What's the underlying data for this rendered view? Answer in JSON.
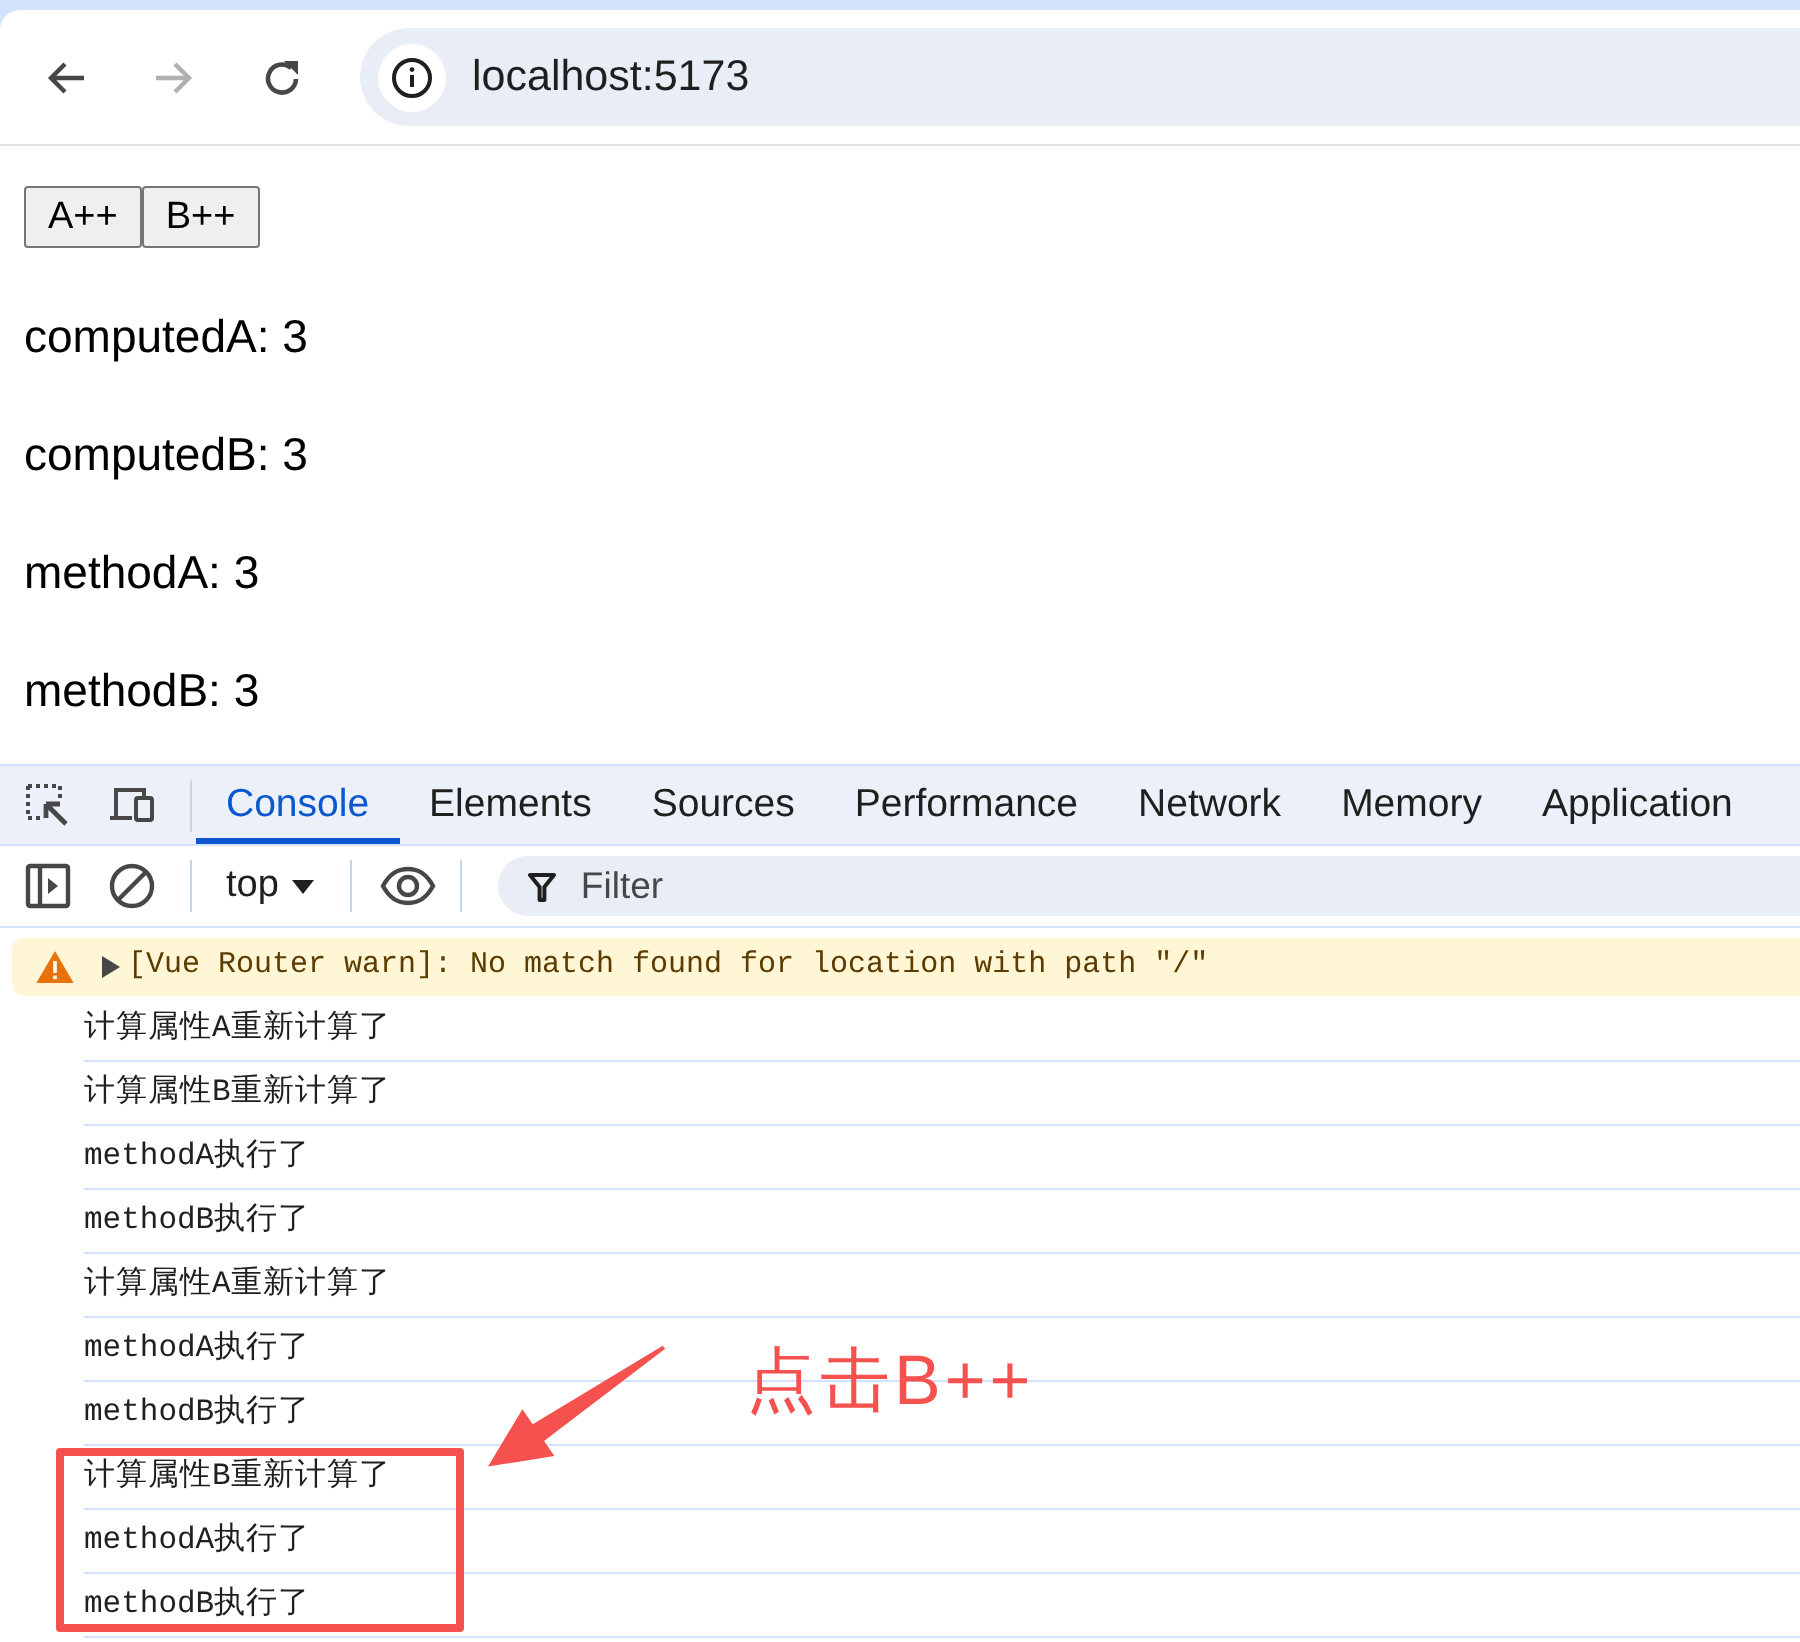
{
  "browser": {
    "nav_buttons": [
      {
        "kind": "back",
        "disabled": false
      },
      {
        "kind": "forward",
        "disabled": true
      },
      {
        "kind": "reload",
        "disabled": false
      }
    ],
    "address": "localhost:5173"
  },
  "page": {
    "buttons": [
      "A++",
      "B++"
    ],
    "lines": [
      "computedA: 3",
      "computedB: 3",
      "methodA: 3",
      "methodB: 3"
    ]
  },
  "devtools": {
    "tabs": [
      {
        "label": "Console",
        "selected": true
      },
      {
        "label": "Elements",
        "selected": false
      },
      {
        "label": "Sources",
        "selected": false
      },
      {
        "label": "Performance",
        "selected": false
      },
      {
        "label": "Network",
        "selected": false
      },
      {
        "label": "Memory",
        "selected": false
      },
      {
        "label": "Application",
        "selected": false
      }
    ],
    "console_toolbar": {
      "context": "top",
      "filter": {
        "placeholder": "Filter"
      }
    },
    "messages": [
      {
        "kind": "warning",
        "text": "[Vue Router warn]: No match found for location with path \"/\"",
        "expanded": false
      },
      {
        "kind": "log",
        "text": "计算属性A重新计算了",
        "highlighted": false
      },
      {
        "kind": "log",
        "text": "计算属性B重新计算了",
        "highlighted": false
      },
      {
        "kind": "log",
        "text": "methodA执行了",
        "highlighted": false
      },
      {
        "kind": "log",
        "text": "methodB执行了",
        "highlighted": false
      },
      {
        "kind": "log",
        "text": "计算属性A重新计算了",
        "highlighted": false
      },
      {
        "kind": "log",
        "text": "methodA执行了",
        "highlighted": false
      },
      {
        "kind": "log",
        "text": "methodB执行了",
        "highlighted": false
      },
      {
        "kind": "log",
        "text": "计算属性B重新计算了",
        "highlighted": true
      },
      {
        "kind": "log",
        "text": "methodA执行了",
        "highlighted": true
      },
      {
        "kind": "log",
        "text": "methodB执行了",
        "highlighted": true
      }
    ]
  },
  "annotation": {
    "text": "点击B++"
  }
}
